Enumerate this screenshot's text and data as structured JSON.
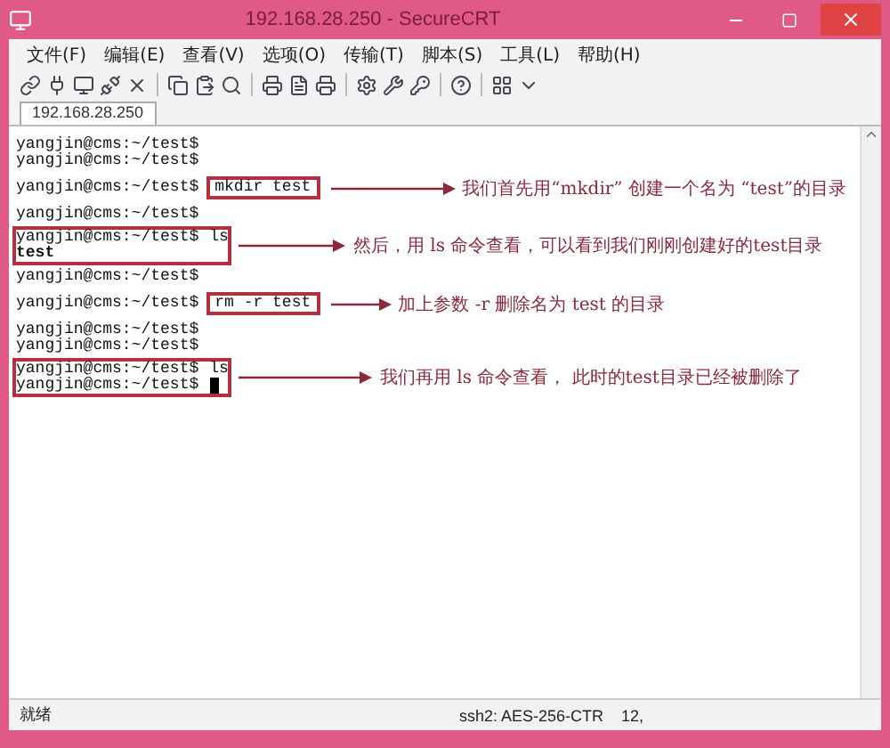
{
  "window": {
    "title": "192.168.28.250 - SecureCRT"
  },
  "menu": [
    "文件(F)",
    "编辑(E)",
    "查看(V)",
    "选项(O)",
    "传输(T)",
    "脚本(S)",
    "工具(L)",
    "帮助(H)"
  ],
  "tabs": [
    {
      "label": "192.168.28.250",
      "selected": true
    }
  ],
  "terminal": {
    "entries": [
      {
        "kind": "plain",
        "lines": [
          {
            "prompt": "yangjin@cms:~/test$"
          },
          {
            "prompt": "yangjin@cms:~/test$"
          }
        ]
      },
      {
        "kind": "command-box",
        "lines": [
          {
            "prompt": "yangjin@cms:~/test$",
            "command": "mkdir test"
          }
        ],
        "note": "我们首先用“mkdir” 创建一个名为 “test”的目录"
      },
      {
        "kind": "plain",
        "lines": [
          {
            "prompt": "yangjin@cms:~/test$"
          }
        ]
      },
      {
        "kind": "block-box",
        "lines": [
          {
            "prompt": "yangjin@cms:~/test$",
            "command": "ls"
          },
          {
            "output": "test"
          }
        ],
        "note": "然后，用 ls 命令查看，可以看到我们刚刚创建好的test目录"
      },
      {
        "kind": "plain",
        "lines": [
          {
            "prompt": "yangjin@cms:~/test$"
          }
        ]
      },
      {
        "kind": "command-box",
        "lines": [
          {
            "prompt": "yangjin@cms:~/test$",
            "command": "rm -r test"
          }
        ],
        "note": "加上参数 -r 删除名为 test 的目录"
      },
      {
        "kind": "plain",
        "lines": [
          {
            "prompt": "yangjin@cms:~/test$"
          },
          {
            "prompt": "yangjin@cms:~/test$"
          }
        ]
      },
      {
        "kind": "block-box",
        "lines": [
          {
            "prompt": "yangjin@cms:~/test$",
            "command": "ls"
          },
          {
            "prompt": "yangjin@cms:~/test$",
            "cursor": true
          }
        ],
        "note": "我们再用 ls 命令查看， 此时的test目录已经被删除了"
      }
    ]
  },
  "status_bar": {
    "state": "就绪",
    "cipher": "ssh2: AES-256-CTR",
    "column_3": "12,"
  }
}
